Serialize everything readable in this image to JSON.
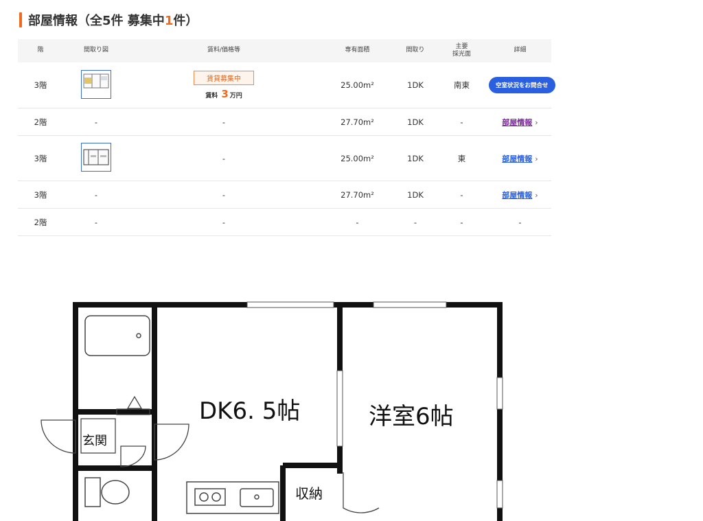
{
  "section": {
    "title_prefix": "部屋情報（全",
    "total": "5",
    "title_mid": "件 募集中",
    "recruiting": "1",
    "title_suffix": "件）"
  },
  "table": {
    "headers": {
      "floor": "階",
      "layout_img": "間取り図",
      "rent": "賃料/価格等",
      "area": "専有面積",
      "layout": "間取り",
      "light1": "主要",
      "light2": "採光面",
      "detail": "詳細"
    },
    "rows": [
      {
        "floor": "3階",
        "layout_img": "",
        "rent_badge": "賃貸募集中",
        "rent_prefix": "賃料",
        "rent_value": "3",
        "rent_unit": "万円",
        "area": "25.00m²",
        "layout": "1DK",
        "light": "南東",
        "action": "空室状況をお問合せ"
      },
      {
        "floor": "2階",
        "layout_img": "-",
        "rent": "-",
        "area": "27.70m²",
        "layout": "1DK",
        "light": "-",
        "action": "部屋情報",
        "action_state": "visited"
      },
      {
        "floor": "3階",
        "layout_img": "",
        "rent": "-",
        "area": "25.00m²",
        "layout": "1DK",
        "light": "東",
        "action": "部屋情報"
      },
      {
        "floor": "3階",
        "layout_img": "-",
        "rent": "-",
        "area": "27.70m²",
        "layout": "1DK",
        "light": "-",
        "action": "部屋情報"
      },
      {
        "floor": "2階",
        "layout_img": "-",
        "rent": "-",
        "area": "-",
        "layout": "-",
        "light": "-",
        "action": "-"
      }
    ]
  },
  "floorplan": {
    "dk_label": "DK6. 5帖",
    "western_room_label": "洋室6帖",
    "entrance_label": "玄関",
    "storage_label": "収納"
  },
  "colors": {
    "accent": "#f06a1d",
    "primary_button": "#2a5fe0",
    "visited_link": "#7a2a9a",
    "header_bg": "#f5f5f5"
  }
}
